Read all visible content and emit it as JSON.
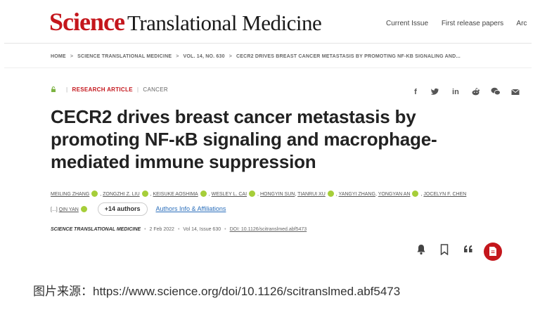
{
  "header": {
    "logo_science": "Science",
    "logo_rest": "Translational Medicine",
    "nav": [
      "Current Issue",
      "First release papers",
      "Arc"
    ]
  },
  "breadcrumb": [
    "HOME",
    "SCIENCE TRANSLATIONAL MEDICINE",
    "VOL. 14, NO. 630",
    "CECR2 DRIVES BREAST CANCER METASTASIS BY PROMOTING NF-KB SIGNALING AND..."
  ],
  "article": {
    "type": "RESEARCH ARTICLE",
    "subject": "CANCER",
    "title": "CECR2 drives breast cancer metastasis by promoting NF-κB signaling and macrophage-mediated immune suppression",
    "authors_line1": [
      "MEILING ZHANG",
      "ZONGZHI Z. LIU",
      "KEISUKE AOSHIMA",
      "WESLEY L. CAI",
      "HONGYIN SUN",
      "TIANRUI XU",
      "YANGYI ZHANG",
      "YONGYAN AN",
      "JOCELYN F. CHEN"
    ],
    "authors_line2": [
      "QIN YAN"
    ],
    "more_authors": "+14 authors",
    "affiliations_link": "Authors Info & Affiliations",
    "journal": "SCIENCE TRANSLATIONAL MEDICINE",
    "date": "2 Feb 2022",
    "volume": "Vol 14, Issue 630",
    "doi": "DOI: 10.1126/scitranslmed.abf5473"
  },
  "share_icons": [
    "facebook-icon",
    "twitter-icon",
    "linkedin-icon",
    "reddit-icon",
    "wechat-icon",
    "email-icon"
  ],
  "action_icons": [
    "alert-bell-icon",
    "bookmark-icon",
    "cite-quote-icon",
    "pdf-icon"
  ],
  "caption": "图片来源：https://www.science.org/doi/10.1126/scitranslmed.abf5473",
  "colors": {
    "brand": "#c4161c",
    "orcid": "#a6ce39",
    "link": "#2a6ebb"
  }
}
